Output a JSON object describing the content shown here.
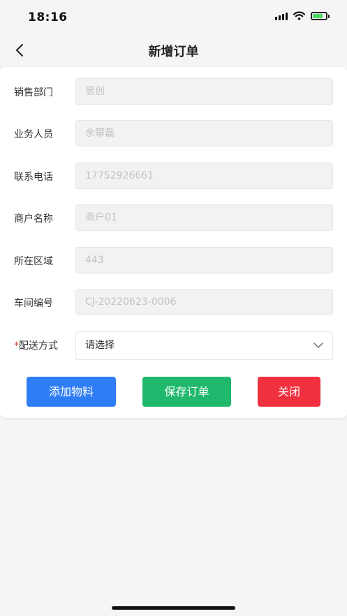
{
  "status_bar": {
    "time": "18:16"
  },
  "nav": {
    "title": "新增订单"
  },
  "form": {
    "fields": [
      {
        "label": "销售部门",
        "value": "昱创"
      },
      {
        "label": "业务人员",
        "value": "余攀磊"
      },
      {
        "label": "联系电话",
        "value": "17752926661"
      },
      {
        "label": "商户名称",
        "value": "商户01"
      },
      {
        "label": "所在区域",
        "value": "443"
      },
      {
        "label": "车间编号",
        "value": "CJ-20220623-0006"
      }
    ],
    "delivery": {
      "required_mark": "*",
      "label": "配送方式",
      "placeholder": "请选择"
    }
  },
  "actions": {
    "add_material": "添加物料",
    "save_order": "保存订单",
    "close": "关闭"
  },
  "colors": {
    "blue": "#2f7df6",
    "green": "#1fb86c",
    "red": "#f0303f",
    "required": "#d94545"
  },
  "icons": {
    "back": "chevron-left-icon",
    "dropdown": "chevron-down-icon",
    "signal": "signal-icon",
    "wifi": "wifi-icon",
    "battery": "battery-charging-icon"
  }
}
